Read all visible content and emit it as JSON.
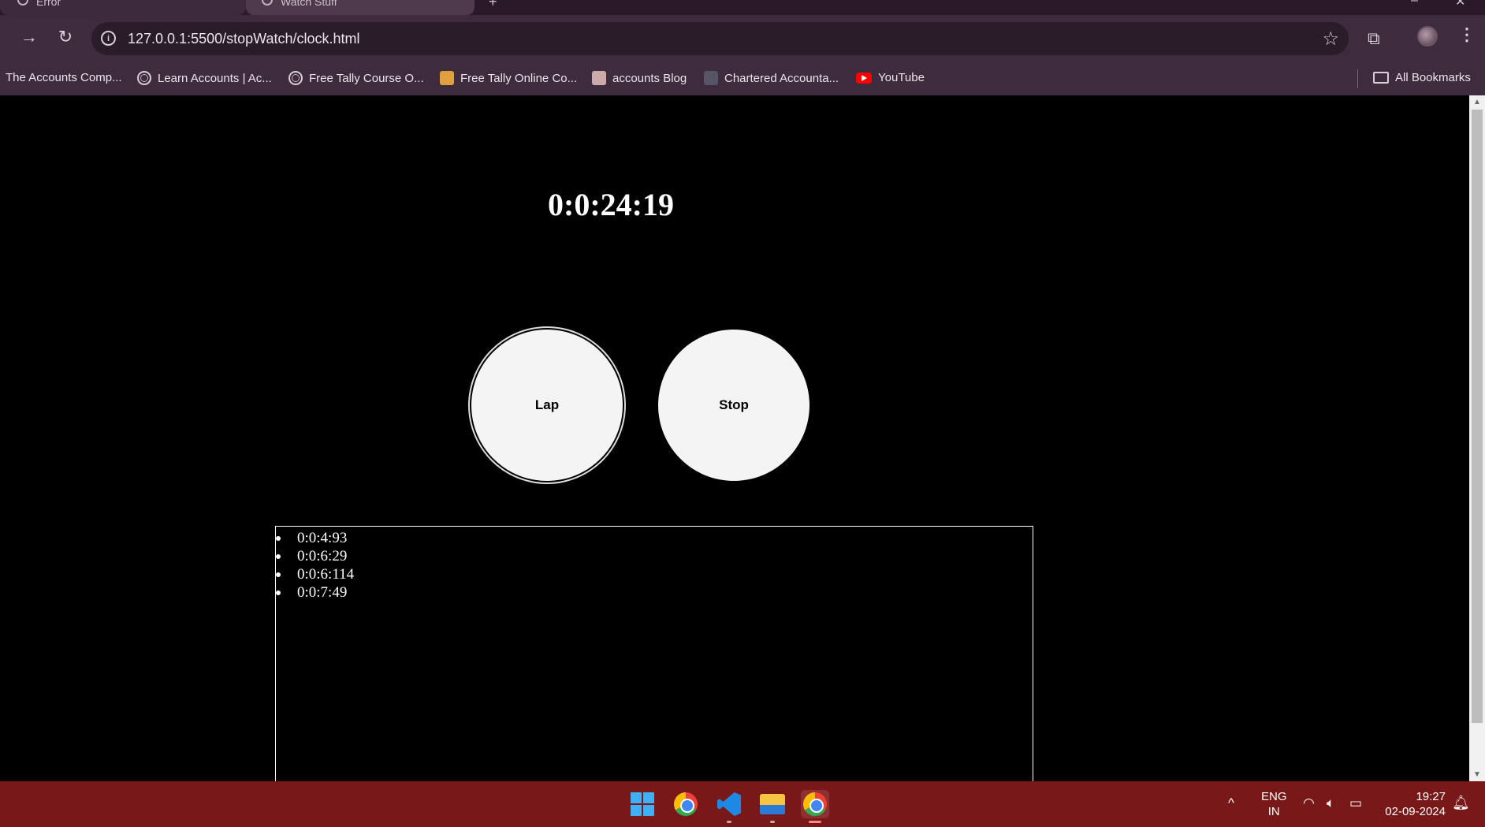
{
  "browser": {
    "tabs": [
      {
        "label": "Error"
      },
      {
        "label": "Watch Stuff"
      }
    ],
    "new_tab_glyph": "+",
    "url": "127.0.0.1:5500/stopWatch/clock.html",
    "bookmarks": [
      {
        "label": "The Accounts Comp...",
        "icon": "none"
      },
      {
        "label": "Learn Accounts | Ac...",
        "icon": "globe-icon"
      },
      {
        "label": "Free Tally Course O...",
        "icon": "globe-icon"
      },
      {
        "label": "Free Tally Online Co...",
        "icon": "runner-icon"
      },
      {
        "label": "accounts Blog",
        "icon": "person-icon"
      },
      {
        "label": "Chartered Accounta...",
        "icon": "person-icon"
      },
      {
        "label": "YouTube",
        "icon": "youtube-icon"
      }
    ],
    "all_bookmarks": "All Bookmarks"
  },
  "stopwatch": {
    "time": "0:0:24:19",
    "lap_label": "Lap",
    "stop_label": "Stop",
    "laps": [
      "0:0:4:93",
      "0:0:6:29",
      "0:0:6:114",
      "0:0:7:49"
    ]
  },
  "taskbar": {
    "apps": [
      "windows-start",
      "chrome",
      "vscode",
      "file-explorer",
      "chrome-profile"
    ],
    "lang_top": "ENG",
    "lang_bottom": "IN",
    "time": "19:27",
    "date": "02-09-2024"
  },
  "colors": {
    "chrome_bg": "#3e2b3d",
    "page_bg": "#000000",
    "button_bg": "#f4f4f4",
    "taskbar_bg": "#791818"
  }
}
